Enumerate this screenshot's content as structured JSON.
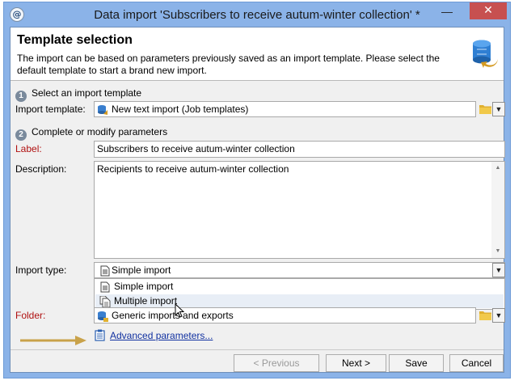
{
  "window": {
    "title": "Data import 'Subscribers to receive autum-winter collection' *",
    "app_icon": "adobe-campaign-icon",
    "minimize_glyph": "—",
    "close_glyph": "✕"
  },
  "header": {
    "title": "Template selection",
    "description": "The import can be based on parameters previously saved as an import template. Please select the default template to start a brand new import.",
    "icon": "database-import-icon"
  },
  "step1": {
    "number": "1",
    "label": "Select an import template"
  },
  "import_template": {
    "label": "Import template:",
    "value": "New text import (Job templates)"
  },
  "step2": {
    "number": "2",
    "label": "Complete or modify parameters"
  },
  "label_field": {
    "label": "Label:",
    "value": "Subscribers to receive autum-winter collection"
  },
  "description_field": {
    "label": "Description:",
    "value": "Recipients to receive autum-winter collection"
  },
  "import_type": {
    "label": "Import type:",
    "value": "Simple import",
    "options": [
      "Simple import",
      "Multiple import"
    ],
    "highlighted": "Multiple import"
  },
  "folder": {
    "label": "Folder:",
    "value": "Generic imports and exports"
  },
  "advanced_link": {
    "label": "Advanced parameters..."
  },
  "buttons": {
    "previous": "< Previous",
    "next": "Next >",
    "save": "Save",
    "cancel": "Cancel"
  },
  "colors": {
    "title_bar": "#8bb3e8",
    "close_button": "#c75050",
    "required_label": "#b01010",
    "link": "#1030a0",
    "arrow": "#c9a24a"
  }
}
